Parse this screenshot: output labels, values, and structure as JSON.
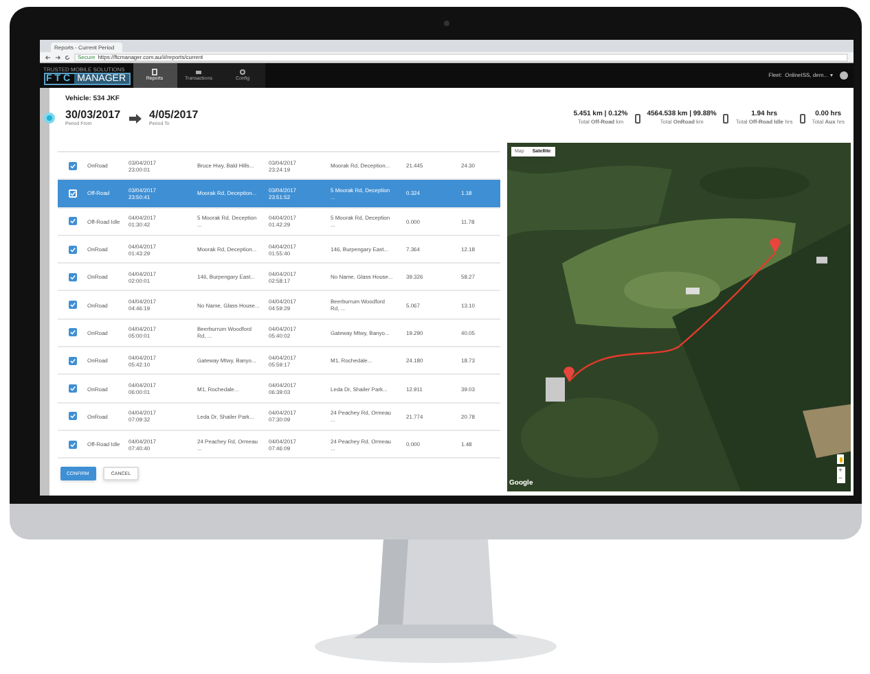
{
  "browser": {
    "tab_title": "Reports - Current Period",
    "secure_label": "Secure",
    "url": "https://ftcmanager.com.au/#/reports/current"
  },
  "app_header": {
    "logo_tagline": "TRUSTED MOBILE SOLUTIONS",
    "logo_left": "FTC",
    "logo_right": "MANAGER",
    "nav": [
      {
        "label": "Reports",
        "selected": true
      },
      {
        "label": "Transactions",
        "selected": false
      },
      {
        "label": "Config",
        "selected": false
      }
    ],
    "fleet_label": "Fleet:",
    "fleet_value": "OnlineISS, dem..."
  },
  "vehicle": {
    "title": "Vehicle: 534 JKF",
    "period_from": "30/03/2017",
    "period_from_label": "Period From",
    "period_to": "4/05/2017",
    "period_to_label": "Period To"
  },
  "stats": [
    {
      "value": "5.451 km | 0.12%",
      "label": "Total **Off-Road** km"
    },
    {
      "value": "4564.538 km | 99.88%",
      "label": "Total **OnRoad** km"
    },
    {
      "value": "1.94 hrs",
      "label": "Total **Off-Road Idle** hrs"
    },
    {
      "value": "0.00 hrs",
      "label": "Total **Aux** hrs"
    }
  ],
  "rows": [
    {
      "checked": true,
      "selected": false,
      "mode": "OnRoad",
      "start_time": "03/04/2017\n23:00:01",
      "start_location": "Bruce Hwy, Bald Hills...",
      "end_time": "03/04/2017\n23:24:19",
      "end_location": "Moorak Rd, Deception...",
      "column_7": "21.445",
      "column_8": "24.30"
    },
    {
      "checked": true,
      "selected": true,
      "mode": "Off-Road",
      "start_time": "03/04/2017\n23:50:41",
      "start_location": "Moorak Rd, Deception...",
      "end_time": "03/04/2017\n23:51:52",
      "end_location": "5 Moorak Rd, Deception\n...",
      "column_7": "0.324",
      "column_8": "1.18"
    },
    {
      "checked": true,
      "selected": false,
      "mode": "Off-Road Idle",
      "start_time": "04/04/2017\n01:30:42",
      "start_location": "5 Moorak Rd, Deception\n...",
      "end_time": "04/04/2017\n01:42:29",
      "end_location": "5 Moorak Rd, Deception\n...",
      "column_7": "0.000",
      "column_8": "11.78"
    },
    {
      "checked": true,
      "selected": false,
      "mode": "OnRoad",
      "start_time": "04/04/2017\n01:43:29",
      "start_location": "Moorak Rd, Deception...",
      "end_time": "04/04/2017\n01:55:40",
      "end_location": "146, Burpengary East...",
      "column_7": "7.364",
      "column_8": "12.18"
    },
    {
      "checked": true,
      "selected": false,
      "mode": "OnRoad",
      "start_time": "04/04/2017\n02:00:01",
      "start_location": "146, Burpengary East...",
      "end_time": "04/04/2017\n02:58:17",
      "end_location": "No Name, Glass House...",
      "column_7": "39.326",
      "column_8": "58.27"
    },
    {
      "checked": true,
      "selected": false,
      "mode": "OnRoad",
      "start_time": "04/04/2017\n04:46:19",
      "start_location": "No Name, Glass House...",
      "end_time": "04/04/2017\n04:59:29",
      "end_location": "Beerburrum Woodford\nRd, ...",
      "column_7": "5.067",
      "column_8": "13.10"
    },
    {
      "checked": true,
      "selected": false,
      "mode": "OnRoad",
      "start_time": "04/04/2017\n05:00:01",
      "start_location": "Beerburrum Woodford\nRd, ...",
      "end_time": "04/04/2017\n05:40:02",
      "end_location": "Gateway Mtwy, Banyo...",
      "column_7": "19.290",
      "column_8": "40.05"
    },
    {
      "checked": true,
      "selected": false,
      "mode": "OnRoad",
      "start_time": "04/04/2017\n05:42:10",
      "start_location": "Gateway Mtwy, Banyo...",
      "end_time": "04/04/2017\n05:59:17",
      "end_location": "M1, Rochedale...",
      "column_7": "24.180",
      "column_8": "18.73"
    },
    {
      "checked": true,
      "selected": false,
      "mode": "OnRoad",
      "start_time": "04/04/2017\n06:00:01",
      "start_location": "M1, Rochedale...",
      "end_time": "04/04/2017\n06:39:03",
      "end_location": "Leda Dr, Shailer Park...",
      "column_7": "12.911",
      "column_8": "39.03"
    },
    {
      "checked": true,
      "selected": false,
      "mode": "OnRoad",
      "start_time": "04/04/2017\n07:09:32",
      "start_location": "Leda Dr, Shailer Park...",
      "end_time": "04/04/2017\n07:30:09",
      "end_location": "24 Peachey Rd, Ormeau\n...",
      "column_7": "21.774",
      "column_8": "20.78"
    },
    {
      "checked": true,
      "selected": false,
      "mode": "Off-Road Idle",
      "start_time": "04/04/2017\n07:40:40",
      "start_location": "24 Peachey Rd, Ormeau\n...",
      "end_time": "04/04/2017\n07:46:09",
      "end_location": "24 Peachey Rd, Ormeau\n...",
      "column_7": "0.000",
      "column_8": "1.48"
    }
  ],
  "buttons": [
    {
      "label": "CONFIRM",
      "kind": "primary"
    },
    {
      "label": "CANCEL",
      "kind": "secondary"
    }
  ],
  "map": {
    "kind": "picture",
    "map_types": [
      {
        "label": "Map",
        "selected": false
      },
      {
        "label": "Satellite",
        "selected": true
      }
    ],
    "google_label": "Google",
    "zoom_in": "+",
    "zoom_out": "−"
  }
}
